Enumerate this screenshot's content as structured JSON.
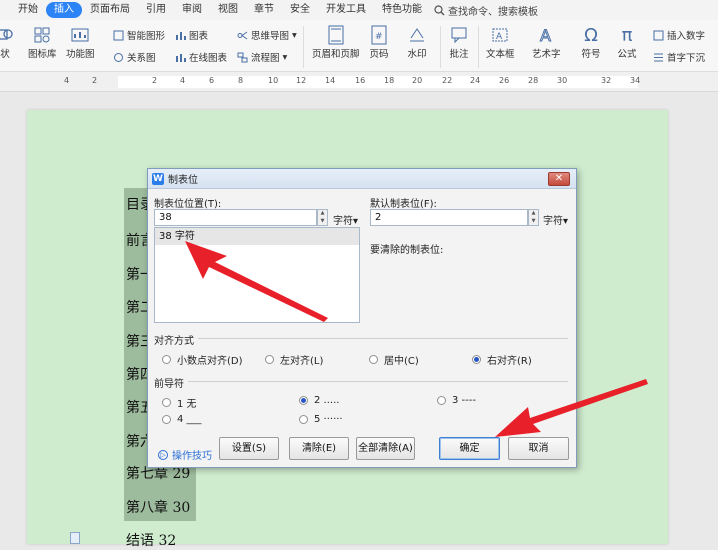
{
  "menu": {
    "tabs": [
      "开始",
      "插入",
      "页面布局",
      "引用",
      "审阅",
      "视图",
      "章节",
      "安全",
      "开发工具",
      "特色功能"
    ],
    "active_tab": "插入",
    "search_label": "查找命令、搜索模板"
  },
  "ribbon": {
    "shape_partial": "状",
    "icon_library": "图标库",
    "function_chart": "功能图",
    "smart_shape": "智能图形",
    "relation_chart": "关系图",
    "chart": "图表",
    "online_chart": "在线图表",
    "mind_map": "思维导图",
    "flowchart": "流程图",
    "header_footer": "页眉和页脚",
    "page_number": "页码",
    "watermark": "水印",
    "comment": "批注",
    "textbox": "文本框",
    "art_text": "艺术字",
    "symbol": "符号",
    "formula": "公式",
    "insert_number": "插入数字",
    "drop_cap": "首字下沉"
  },
  "ruler": {
    "numbers": [
      "4",
      "2",
      "2",
      "4",
      "6",
      "8",
      "10",
      "12",
      "14",
      "16",
      "18",
      "20",
      "22",
      "24",
      "26",
      "28",
      "30",
      "32",
      "34"
    ]
  },
  "document": {
    "toc_lines": [
      "目录",
      "前言",
      "第一",
      "第二",
      "第三",
      "第四",
      "第五",
      "第六",
      "第七章 29",
      "第八章 30",
      "结语 32"
    ]
  },
  "dialog": {
    "title": "制表位",
    "tab_position_label": "制表位位置(T):",
    "tab_position_value": "38",
    "tab_position_unit": "字符",
    "default_tab_label": "默认制表位(F):",
    "default_tab_value": "2",
    "default_tab_unit": "字符",
    "to_clear_label": "要清除的制表位:",
    "list_items": [
      "38 字符"
    ],
    "alignment_label": "对齐方式",
    "alignment_options": [
      "小数点对齐(D)",
      "左对齐(L)",
      "居中(C)",
      "右对齐(R)"
    ],
    "alignment_selected": "右对齐(R)",
    "leader_label": "前导符",
    "leader_options": [
      "1 无",
      "2 .....",
      "3 ----",
      "4 ___",
      "5 ······"
    ],
    "leader_selected": "2 .....",
    "tips_label": "操作技巧",
    "set_button": "设置(S)",
    "clear_button": "清除(E)",
    "clear_all_button": "全部清除(A)",
    "ok_button": "确定",
    "cancel_button": "取消"
  },
  "colors": {
    "accent": "#2b83f6",
    "page_bg": "#cfeccf",
    "highlight": "#9dbb9d",
    "arrow": "#e8202a"
  }
}
